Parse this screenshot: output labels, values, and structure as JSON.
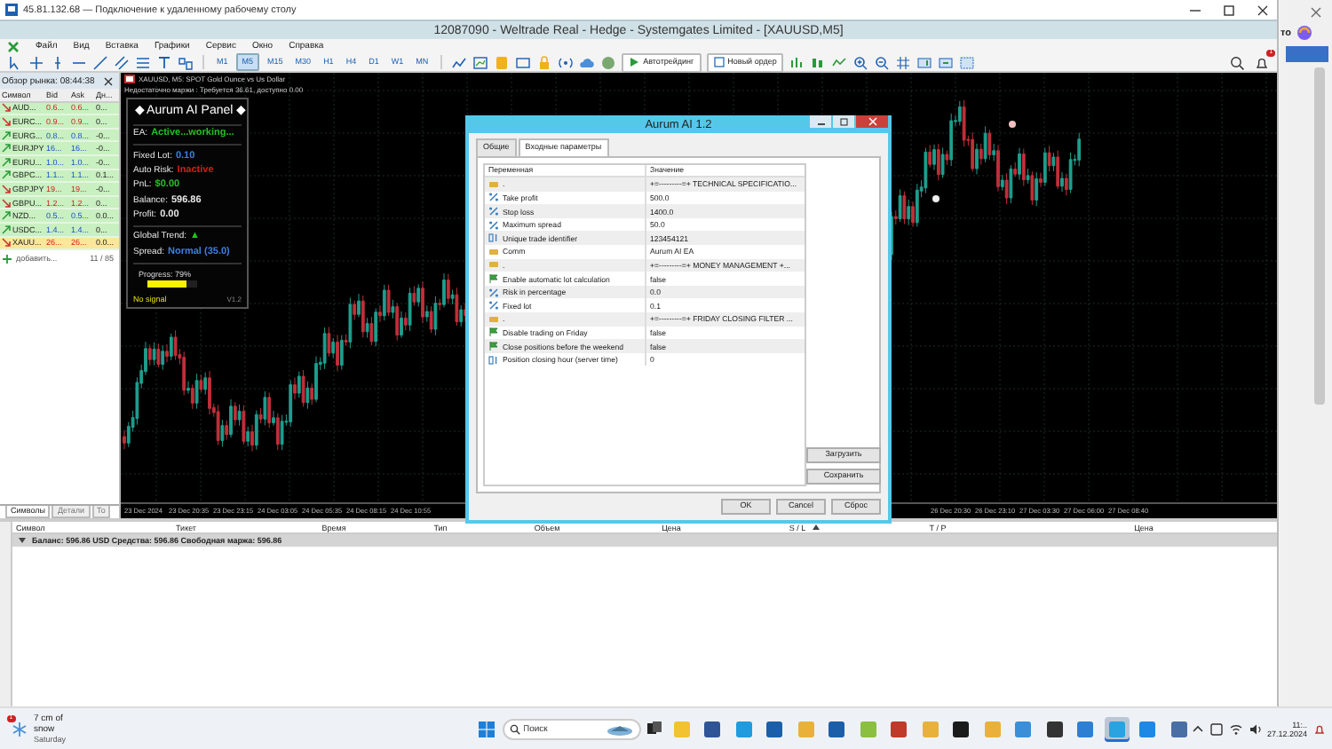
{
  "remote_window": {
    "title": "45.81.132.68 — Подключение к удаленному рабочему столу"
  },
  "app_window": {
    "title": "12087090 - Weltrade Real - Hedge - Systemgates Limited - [XAUUSD,M5]"
  },
  "menu": [
    "Файл",
    "Вид",
    "Вставка",
    "Графики",
    "Сервис",
    "Окно",
    "Справка"
  ],
  "toolbar": {
    "timeframes": [
      {
        "label": "M1",
        "selected": false
      },
      {
        "label": "M5",
        "selected": true
      },
      {
        "label": "M15",
        "selected": false
      },
      {
        "label": "M30",
        "selected": false
      },
      {
        "label": "H1",
        "selected": false
      },
      {
        "label": "H4",
        "selected": false
      },
      {
        "label": "D1",
        "selected": false
      },
      {
        "label": "W1",
        "selected": false
      },
      {
        "label": "MN",
        "selected": false
      }
    ],
    "autotrading": "Автотрейдинг",
    "new_order": "Новый ордер",
    "notifications": "1"
  },
  "market_watch": {
    "title": "Обзор рынка: 08:44:38",
    "columns": [
      "Символ",
      "Bid",
      "Ask",
      "Дн..."
    ],
    "rows": [
      {
        "symbol": "AUD...",
        "bid": "0.6...",
        "ask": "0.6...",
        "change": "0...",
        "rising": false,
        "selected": false
      },
      {
        "symbol": "EURC...",
        "bid": "0.9...",
        "ask": "0.9...",
        "change": "0...",
        "rising": false,
        "selected": false
      },
      {
        "symbol": "EURG...",
        "bid": "0.8...",
        "ask": "0.8...",
        "change": "-0...",
        "rising": true,
        "selected": false
      },
      {
        "symbol": "EURJPY",
        "bid": "16...",
        "ask": "16...",
        "change": "-0...",
        "rising": true,
        "selected": false
      },
      {
        "symbol": "EURU...",
        "bid": "1.0...",
        "ask": "1.0...",
        "change": "-0...",
        "rising": true,
        "selected": false
      },
      {
        "symbol": "GBPC...",
        "bid": "1.1...",
        "ask": "1.1...",
        "change": "0.1...",
        "rising": true,
        "selected": false
      },
      {
        "symbol": "GBPJPY",
        "bid": "19...",
        "ask": "19...",
        "change": "-0...",
        "rising": false,
        "selected": false
      },
      {
        "symbol": "GBPU...",
        "bid": "1.2...",
        "ask": "1.2...",
        "change": "0...",
        "rising": false,
        "selected": false
      },
      {
        "symbol": "NZD...",
        "bid": "0.5...",
        "ask": "0.5...",
        "change": "0.0...",
        "rising": true,
        "selected": false
      },
      {
        "symbol": "USDC...",
        "bid": "1.4...",
        "ask": "1.4...",
        "change": "0...",
        "rising": true,
        "selected": false
      },
      {
        "symbol": "XAUU...",
        "bid": "26...",
        "ask": "26...",
        "change": "0.0...",
        "rising": false,
        "selected": true
      }
    ],
    "add": "добавить...",
    "count": "11 / 85",
    "tabs": [
      {
        "label": "Символы",
        "selected": true
      },
      {
        "label": "Детали",
        "selected": false
      },
      {
        "label": "То",
        "selected": false
      }
    ]
  },
  "chart": {
    "header": "XAUUSD, M5:  SPOT Gold Ounce vs Us Dollar",
    "notice": "Недостаточно маржи : Требуется 36.61, доступно 0.00",
    "time_labels_left": [
      "23 Dec 2024",
      "23 Dec 20:35",
      "23 Dec 23:15",
      "24 Dec 03:05",
      "24 Dec 05:35",
      "24 Dec 08:15",
      "24 Dec 10:55"
    ],
    "time_labels_right": [
      "26 Dec 20:30",
      "26 Dec 23:10",
      "27 Dec 03:30",
      "27 Dec 06:00",
      "27 Dec 08:40"
    ]
  },
  "ea_panel": {
    "title": "◆ Aurum AI Panel ◆",
    "lines": [
      {
        "label": "EA:",
        "value": "Active...working...",
        "color": "#22c322"
      },
      {
        "label": "Fixed Lot:",
        "value": "0.10",
        "color": "#3f7fe0"
      },
      {
        "label": "Auto Risk:",
        "value": "Inactive",
        "color": "#d02020"
      },
      {
        "label": "PnL:",
        "value": "$0.00",
        "color": "#22c322"
      },
      {
        "label": "Balance:",
        "value": "596.86",
        "color": "#e8e8e8"
      },
      {
        "label": "Profit:",
        "value": "0.00",
        "color": "#e8e8e8"
      },
      {
        "label": "Global Trend:",
        "value": "▲",
        "color": "#22c322"
      },
      {
        "label": "Spread:",
        "value": "Normal (35.0)",
        "color": "#3f7fe0"
      }
    ],
    "progress": {
      "label": "Progress: 79%",
      "level": 0.79
    },
    "signal": "No signal",
    "version": "V1.2"
  },
  "dialog": {
    "title": "Aurum AI 1.2",
    "tabs": [
      {
        "label": "Общие",
        "selected": false
      },
      {
        "label": "Входные параметры",
        "selected": true
      }
    ],
    "columns": [
      "Переменная",
      "Значение"
    ],
    "params": [
      {
        "kind": "string",
        "name": ".",
        "value": "+=---------=+    TECHNICAL SPECIFICATIO..."
      },
      {
        "kind": "double",
        "name": "Take profit",
        "value": "500.0"
      },
      {
        "kind": "double",
        "name": "Stop loss",
        "value": "1400.0"
      },
      {
        "kind": "double",
        "name": "Maximum spread",
        "value": "50.0"
      },
      {
        "kind": "integer",
        "name": "Unique trade identifier",
        "value": "123454121"
      },
      {
        "kind": "string",
        "name": "Comm",
        "value": "Aurum AI EA"
      },
      {
        "kind": "string",
        "name": ".",
        "value": "+=---------=+    MONEY MANAGEMENT    +..."
      },
      {
        "kind": "bool",
        "name": "Enable automatic lot calculation",
        "value": "false"
      },
      {
        "kind": "double",
        "name": "Risk in percentage",
        "value": "0.0"
      },
      {
        "kind": "double",
        "name": "Fixed lot",
        "value": "0.1"
      },
      {
        "kind": "string",
        "name": ".",
        "value": "+=---------=+    FRIDAY CLOSING FILTER    ..."
      },
      {
        "kind": "bool",
        "name": "Disable trading on Friday",
        "value": "false"
      },
      {
        "kind": "bool",
        "name": "Close positions before the weekend",
        "value": "false"
      },
      {
        "kind": "integer",
        "name": "Position closing hour (server time)",
        "value": "0"
      }
    ],
    "side_buttons": [
      "Загрузить",
      "Сохранить"
    ],
    "buttons": [
      "OK",
      "Cancel",
      "Сброс"
    ]
  },
  "toolbox": {
    "columns": [
      "Символ",
      "Тикет",
      "Время",
      "Тип",
      "Объем",
      "Цена",
      "S / L",
      "T / P",
      "Цена"
    ],
    "summary": "Баланс: 596.86 USD  Средства: 596.86  Свободная маржа: 596.86"
  },
  "side_window": {
    "text": "то"
  },
  "taskbar": {
    "weather": {
      "badge": "1",
      "line1": "7 cm of snow",
      "line2": "Saturday"
    },
    "search": {
      "placeholder": "Поиск"
    },
    "apps": [
      {
        "color": "#f2c230",
        "selected": false
      },
      {
        "color": "#2f5597",
        "selected": false
      },
      {
        "color": "#1f9bde",
        "selected": false
      },
      {
        "color": "#1c5fa8",
        "selected": false
      },
      {
        "color": "#e8b23a",
        "selected": false
      },
      {
        "color": "#1c5fa8",
        "selected": false
      },
      {
        "color": "#8bbf3f",
        "selected": false
      },
      {
        "color": "#c0392b",
        "selected": false
      },
      {
        "color": "#e8b23a",
        "selected": false
      },
      {
        "color": "#1b1b1b",
        "selected": false
      },
      {
        "color": "#e8b23a",
        "selected": false
      },
      {
        "color": "#3a8fd8",
        "selected": false
      },
      {
        "color": "#333333",
        "selected": false
      },
      {
        "color": "#2d7fd3",
        "selected": false
      },
      {
        "color": "#2aa3e0",
        "selected": true
      },
      {
        "color": "#1e88e5",
        "selected": false
      },
      {
        "color": "#4a6fa5",
        "selected": false
      }
    ],
    "time": "11:..",
    "date": "27.12.2024"
  }
}
